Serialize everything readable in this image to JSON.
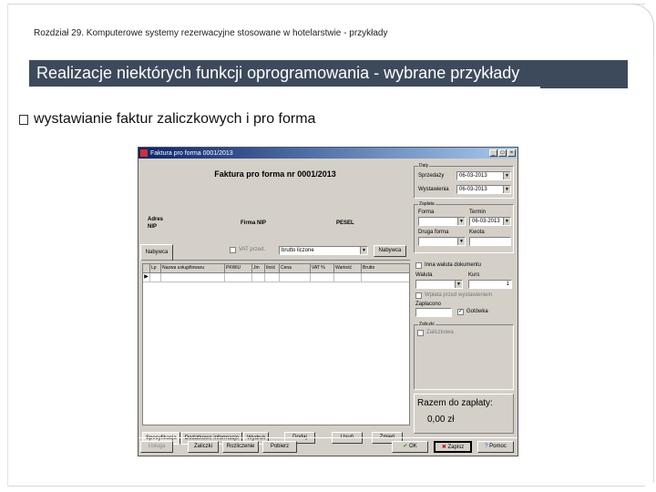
{
  "slide": {
    "chapter": "Rozdział 29. Komputerowe systemy rezerwacyjne stosowane w hotelarstwie - przykłady",
    "title": "Realizacje niektórych funkcji oprogramowania - wybrane przykłady",
    "bullet": "wystawianie faktur zaliczkowych i pro forma"
  },
  "window": {
    "title": "Faktura pro forma 0001/2013",
    "minimize": "_",
    "maximize": "□",
    "close": "×",
    "document_title": "Faktura pro forma nr 0001/2013",
    "adres_label": "Adres",
    "nip_label": "NIP",
    "firm_nip_label": "Firma NIP",
    "pesel_label": "PESEL",
    "vat_checkbox": "VAT przed.",
    "price_mode": "brutto liczone",
    "nabywca_button": "Nabywca",
    "tab_top": "Nabywca",
    "grid_columns": [
      "Lp",
      "Nazwa usługi/towaru",
      "PKWiU",
      "Jm",
      "Ilość",
      "Cena",
      "VAT %",
      "Wartość",
      "Brutto"
    ],
    "tabs": [
      "Specyfikacja",
      "Dodatkowe informacje",
      "Wydruk"
    ],
    "buttons": {
      "dodaj": "Dodaj",
      "usun": "Usuń",
      "zmien": "Zmień",
      "usluga": "Usługa",
      "zaliczki": "Zaliczki",
      "rozliczenie": "Rozliczenie",
      "pobierz": "Pobierz",
      "ok": "OK",
      "zapisz": "Zapisz",
      "pomoc": "Pomoc"
    },
    "daty": {
      "group": "Daty",
      "sprzedazy_label": "Sprzedaży",
      "sprzedazy_value": "06-03-2013",
      "wystawienia_label": "Wystawienia",
      "wystawienia_value": "06-03-2013"
    },
    "zaplata": {
      "group": "Zapłata",
      "forma_label": "Forma",
      "termin_label": "Termin",
      "termin_value": "06-03-2013",
      "druga_forma_label": "Druga forma",
      "kwota_label": "Kwota"
    },
    "options": {
      "inna_waluta": "Inna waluta dokumentu",
      "waluta_label": "Waluta",
      "kurs_label": "Kurs",
      "kurs_value": "1",
      "wplata": "Wpłata przed wystawieniem",
      "zaplacono_label": "Zapłacono",
      "gotowka": "Gotówka"
    },
    "zaliczki_group": {
      "group": "Zaliczki",
      "checkbox": "Zaliczkowa"
    },
    "razem_label": "Razem do zapłaty:",
    "razem_value": "0,00 zł"
  }
}
